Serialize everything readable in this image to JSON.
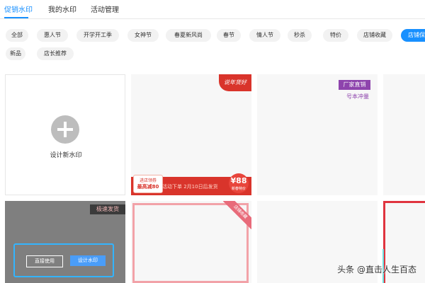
{
  "tabs": [
    "促销水印",
    "我的水印",
    "活动管理"
  ],
  "chips": [
    "全部",
    "惠人节",
    "开学开工季",
    "女神节",
    "春夏新风尚",
    "春节",
    "情人节",
    "秒杀",
    "特价",
    "店铺收藏",
    "店铺保",
    "新品",
    "店长推荐"
  ],
  "card_design": {
    "label": "设计新水印"
  },
  "card_red": {
    "corner_text": "说年货好",
    "banner_text": "活动下单 2月10日后发货",
    "coupon_top": "进店领券",
    "coupon_bottom": "最高减80",
    "price": "¥88",
    "price_sub": "新春特价"
  },
  "card_factory": {
    "badge": "厂家直销",
    "subtitle": "号本冲量"
  },
  "card_dark": {
    "ribbon": "极速发货",
    "btn_direct": "直接使用",
    "btn_design": "设计水印"
  },
  "card_pink": {
    "ribbon": "店铺收藏"
  },
  "watermark": "头条 @直击人生百态",
  "colors": {
    "accent": "#1890ff",
    "promo_red": "#d9342b",
    "purple": "#8e44ad",
    "frame_blue": "#33b4ff"
  }
}
